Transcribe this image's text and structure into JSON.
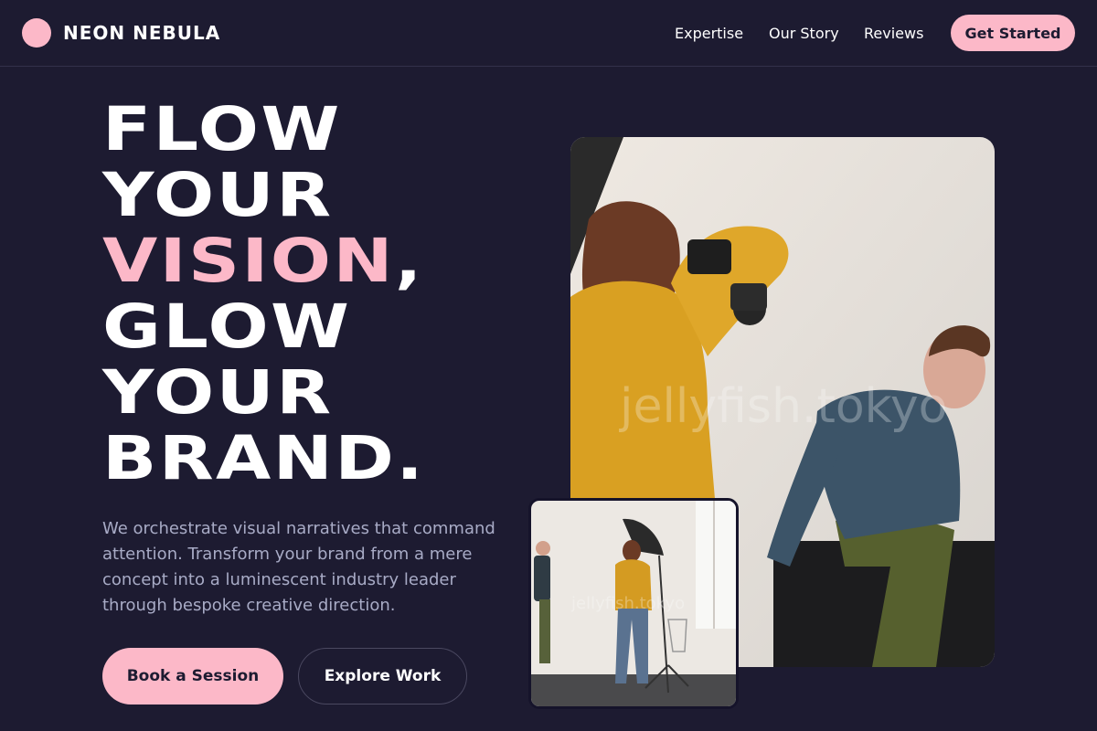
{
  "brand": {
    "name": "NEON NEBULA"
  },
  "nav": {
    "items": [
      {
        "label": "Expertise"
      },
      {
        "label": "Our Story"
      },
      {
        "label": "Reviews"
      }
    ],
    "cta_label": "Get Started"
  },
  "hero": {
    "headline": {
      "line1": "FLOW",
      "line2": "YOUR",
      "line3_accent": "VISION",
      "line3_tail": ",",
      "line4": "GLOW",
      "line5": "YOUR",
      "line6": "BRAND."
    },
    "description": "We orchestrate visual narratives that command attention. Transform your brand from a mere concept into a luminescent industry leader through bespoke creative direction.",
    "primary_button": "Book a Session",
    "secondary_button": "Explore Work"
  },
  "images": {
    "main": {
      "watermark": "jellyfish.tokyo"
    },
    "small": {
      "watermark": "jellyfish.tokyo"
    }
  },
  "colors": {
    "background": "#1d1b31",
    "accent": "#fcb8c8",
    "muted_text": "#a8abc6"
  }
}
